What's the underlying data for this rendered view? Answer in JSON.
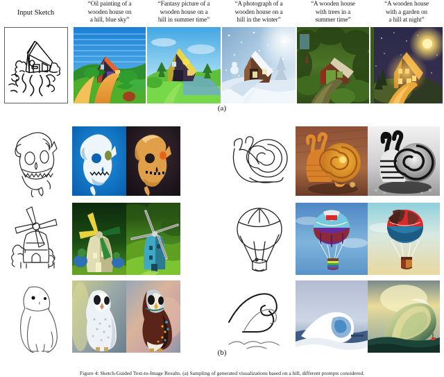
{
  "figure": {
    "panel_a": {
      "sketch_column_label": "Input Sketch",
      "sketch_name": "house-on-a-hill-sketch",
      "prompts": [
        "“Oil painting of a wooden house on a hill, blue sky”",
        "“Fantasy picture of a wooden house on a hill in summer time”",
        "“A photograph of a wooden house on a hill in the winter”",
        "“A wooden house with trees in a summer time”",
        "“A wooden house with a garden on a hill at night”"
      ],
      "prompt_lines": [
        [
          "“Oil painting of a",
          "wooden house on",
          "a hill, blue sky”"
        ],
        [
          "“Fantasy picture of a",
          "wooden house on a",
          "hill in summer time”"
        ],
        [
          "“A photograph of a",
          "wooden house on a",
          "hill in the winter”"
        ],
        [
          "“A wooden house",
          "with trees in a",
          "summer time”"
        ],
        [
          "“A wooden house",
          "with a garden on",
          "a hill at night”"
        ]
      ],
      "subfigure_label": "(a)"
    },
    "panel_b": {
      "subfigure_label": "(b)",
      "groups": [
        {
          "sketch": "animal-skull-sketch",
          "results": [
            "skull-blue-background",
            "skull-dark-background"
          ]
        },
        {
          "sketch": "snail-sketch",
          "results": [
            "snail-orange-photo",
            "snail-monochrome-photo"
          ]
        },
        {
          "sketch": "windmill-sketch",
          "results": [
            "windmill-dark-green",
            "windmill-hillside"
          ]
        },
        {
          "sketch": "hot-air-balloon-sketch",
          "results": [
            "balloon-multicolor",
            "balloon-red-blue"
          ]
        },
        {
          "sketch": "owl-sketch",
          "results": [
            "owl-white-barn",
            "owl-brown-barn"
          ]
        },
        {
          "sketch": "wave-sketch",
          "results": [
            "wave-photograph",
            "wave-painting"
          ]
        }
      ]
    },
    "caption": "Figure 4: Sketch-Guided Text-to-Image Results. (a) Sampling of generated visualizations based on a hill, different prompts considered."
  },
  "colors": {
    "sketch_border": "#5f5f5f",
    "ink": "#111111",
    "page_background": "#ffffff"
  }
}
